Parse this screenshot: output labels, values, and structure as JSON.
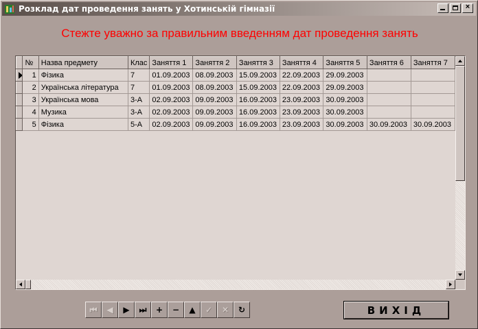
{
  "window": {
    "title": "Розклад дат проведення занять у Хотинській гімназії",
    "icon": "app-icon",
    "buttons": [
      "minimize-icon",
      "maximize-icon",
      "close-icon"
    ]
  },
  "warning": "Стежте уважно за правильним введенням дат проведення занять",
  "colors": {
    "warning": "#ff0000",
    "background": "#ac9e99",
    "grid": "#dfd6d2"
  },
  "grid": {
    "columns": [
      "№",
      "Назва предмету",
      "Клас",
      "Заняття 1",
      "Заняття 2",
      "Заняття 3",
      "Заняття 4",
      "Заняття 5",
      "Заняття 6",
      "Заняття 7"
    ],
    "rows": [
      [
        "1",
        "Фізика",
        "7",
        "01.09.2003",
        "08.09.2003",
        "15.09.2003",
        "22.09.2003",
        "29.09.2003",
        "",
        ""
      ],
      [
        "2",
        "Українська література",
        "7",
        "01.09.2003",
        "08.09.2003",
        "15.09.2003",
        "22.09.2003",
        "29.09.2003",
        "",
        ""
      ],
      [
        "3",
        "Українська мова",
        "3-А",
        "02.09.2003",
        "09.09.2003",
        "16.09.2003",
        "23.09.2003",
        "30.09.2003",
        "",
        ""
      ],
      [
        "4",
        "Музика",
        "3-А",
        "02.09.2003",
        "09.09.2003",
        "16.09.2003",
        "23.09.2003",
        "30.09.2003",
        "",
        ""
      ],
      [
        "5",
        "Фізика",
        "5-А",
        "02.09.2003",
        "09.09.2003",
        "16.09.2003",
        "23.09.2003",
        "30.09.2003",
        "30.09.2003",
        "30.09.2003"
      ]
    ],
    "current_row": 1
  },
  "navigator": {
    "buttons": [
      {
        "name": "first-record",
        "glyph": "⏮",
        "enabled": false
      },
      {
        "name": "prior-record",
        "glyph": "◀",
        "enabled": false
      },
      {
        "name": "next-record",
        "glyph": "▶",
        "enabled": true
      },
      {
        "name": "last-record",
        "glyph": "⏭",
        "enabled": true
      },
      {
        "name": "insert-record",
        "glyph": "+",
        "enabled": true
      },
      {
        "name": "delete-record",
        "glyph": "−",
        "enabled": true
      },
      {
        "name": "edit-record",
        "glyph": "▲",
        "enabled": true
      },
      {
        "name": "post-edit",
        "glyph": "✓",
        "enabled": false
      },
      {
        "name": "cancel-edit",
        "glyph": "✕",
        "enabled": false
      },
      {
        "name": "refresh-data",
        "glyph": "↻",
        "enabled": true
      }
    ]
  },
  "exit_label": "ВИХІД"
}
